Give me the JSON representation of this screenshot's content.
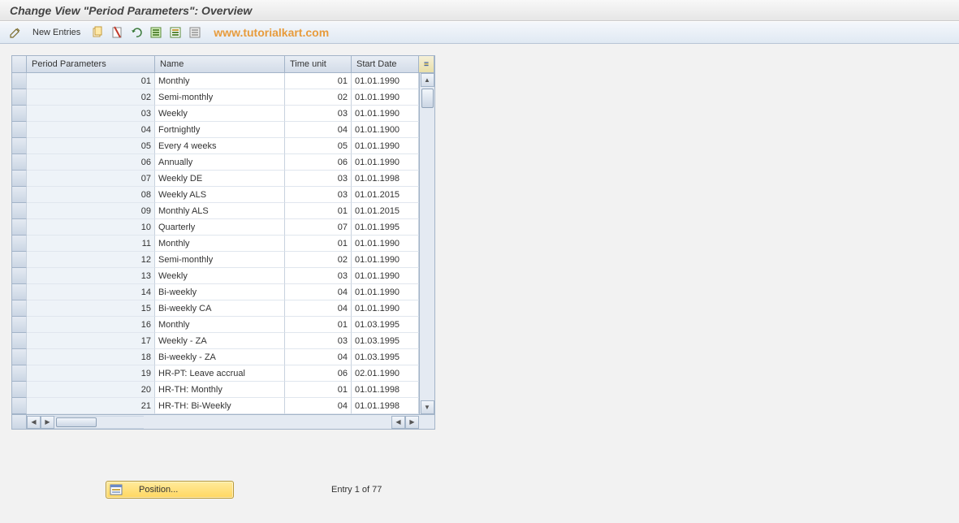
{
  "title": "Change View \"Period Parameters\": Overview",
  "toolbar": {
    "new_entries_label": "New Entries",
    "watermark": "www.tutorialkart.com"
  },
  "grid": {
    "columns": {
      "period_parameters": "Period Parameters",
      "name": "Name",
      "time_unit": "Time unit",
      "start_date": "Start Date"
    },
    "rows": [
      {
        "pp": "01",
        "name": "Monthly",
        "tu": "01",
        "sd": "01.01.1990"
      },
      {
        "pp": "02",
        "name": "Semi-monthly",
        "tu": "02",
        "sd": "01.01.1990"
      },
      {
        "pp": "03",
        "name": "Weekly",
        "tu": "03",
        "sd": "01.01.1990"
      },
      {
        "pp": "04",
        "name": "Fortnightly",
        "tu": "04",
        "sd": "01.01.1900"
      },
      {
        "pp": "05",
        "name": "Every 4 weeks",
        "tu": "05",
        "sd": "01.01.1990"
      },
      {
        "pp": "06",
        "name": "Annually",
        "tu": "06",
        "sd": "01.01.1990"
      },
      {
        "pp": "07",
        "name": "Weekly  DE",
        "tu": "03",
        "sd": "01.01.1998"
      },
      {
        "pp": "08",
        "name": "Weekly ALS",
        "tu": "03",
        "sd": "01.01.2015"
      },
      {
        "pp": "09",
        "name": "Monthly ALS",
        "tu": "01",
        "sd": "01.01.2015"
      },
      {
        "pp": "10",
        "name": "Quarterly",
        "tu": "07",
        "sd": "01.01.1995"
      },
      {
        "pp": "11",
        "name": "Monthly",
        "tu": "01",
        "sd": "01.01.1990"
      },
      {
        "pp": "12",
        "name": "Semi-monthly",
        "tu": "02",
        "sd": "01.01.1990"
      },
      {
        "pp": "13",
        "name": "Weekly",
        "tu": "03",
        "sd": "01.01.1990"
      },
      {
        "pp": "14",
        "name": "Bi-weekly",
        "tu": "04",
        "sd": "01.01.1990"
      },
      {
        "pp": "15",
        "name": "Bi-weekly CA",
        "tu": "04",
        "sd": "01.01.1990"
      },
      {
        "pp": "16",
        "name": "Monthly",
        "tu": "01",
        "sd": "01.03.1995"
      },
      {
        "pp": "17",
        "name": "Weekly - ZA",
        "tu": "03",
        "sd": "01.03.1995"
      },
      {
        "pp": "18",
        "name": "Bi-weekly - ZA",
        "tu": "04",
        "sd": "01.03.1995"
      },
      {
        "pp": "19",
        "name": "HR-PT: Leave accrual",
        "tu": "06",
        "sd": "02.01.1990"
      },
      {
        "pp": "20",
        "name": "HR-TH: Monthly",
        "tu": "01",
        "sd": "01.01.1998"
      },
      {
        "pp": "21",
        "name": "HR-TH: Bi-Weekly",
        "tu": "04",
        "sd": "01.01.1998"
      }
    ]
  },
  "footer": {
    "position_label": "Position...",
    "entry_text": "Entry 1 of 77"
  }
}
